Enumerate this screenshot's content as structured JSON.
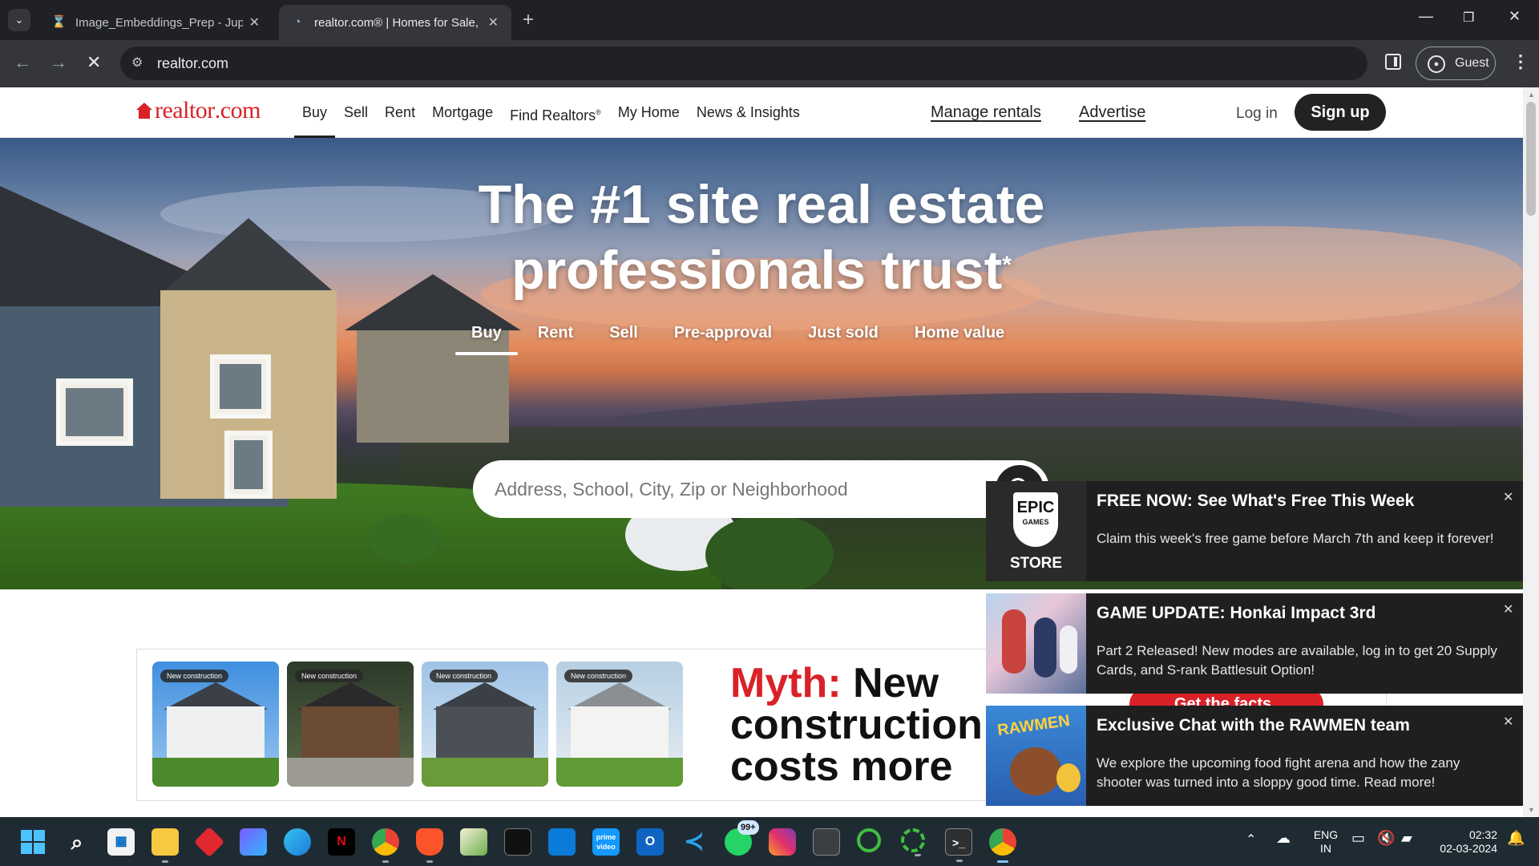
{
  "browser": {
    "tabs": [
      {
        "title": "Image_Embeddings_Prep - Jupy",
        "favicon": "hourglass-icon",
        "active": false
      },
      {
        "title": "realtor.com® | Homes for Sale,",
        "favicon": "loading-spinner-icon",
        "active": true
      }
    ],
    "url": "realtor.com",
    "profile_label": "Guest"
  },
  "site": {
    "logo": {
      "brand": "realtor",
      "suffix": ".com"
    },
    "nav": [
      "Buy",
      "Sell",
      "Rent",
      "Mortgage",
      "Find Realtors",
      "My Home",
      "News & Insights"
    ],
    "nav_active": "Buy",
    "find_realtors_mark": "®",
    "manage_rentals": "Manage rentals",
    "advertise": "Advertise",
    "login": "Log in",
    "signup": "Sign up",
    "accent_color": "#d92228"
  },
  "hero": {
    "title_line1": "The #1 site real estate",
    "title_line2": "professionals trust",
    "title_mark": "*",
    "search_tabs": [
      "Buy",
      "Rent",
      "Sell",
      "Pre-approval",
      "Just sold",
      "Home value"
    ],
    "active_search_tab": "Buy",
    "search_placeholder": "Address, School, City, Zip or Neighborhood",
    "search_value": ""
  },
  "ad": {
    "cards": [
      "New construction",
      "New construction",
      "New construction",
      "New construction"
    ],
    "myth_word": "Myth:",
    "myth_line1": "New",
    "myth_line2": "construction",
    "myth_line3": "costs more",
    "cta": "Get the facts"
  },
  "notifications": [
    {
      "title": "FREE NOW: See What's Free This Week",
      "body": "Claim this week's free game before March 7th and keep it forever!",
      "thumb": "epic-games-store-icon",
      "thumb_label_1": "EPIC",
      "thumb_label_2": "GAMES",
      "thumb_label_3": "STORE"
    },
    {
      "title": "GAME UPDATE: Honkai Impact 3rd",
      "body": "Part 2 Released! New modes are available, log in to get 20 Supply Cards, and S-rank Battlesuit Option!",
      "thumb": "honkai-art-icon"
    },
    {
      "title": "Exclusive Chat with the RAWMEN team",
      "body": "We explore the upcoming food fight arena and how the zany shooter was turned into a sloppy good time. Read more!",
      "thumb": "rawmen-art-icon",
      "thumb_label_1": "RAWMEN"
    }
  ],
  "taskbar": {
    "whatsapp_badge": "99+",
    "lang_line1": "ENG",
    "lang_line2": "IN",
    "time": "02:32",
    "date": "02-03-2024"
  }
}
